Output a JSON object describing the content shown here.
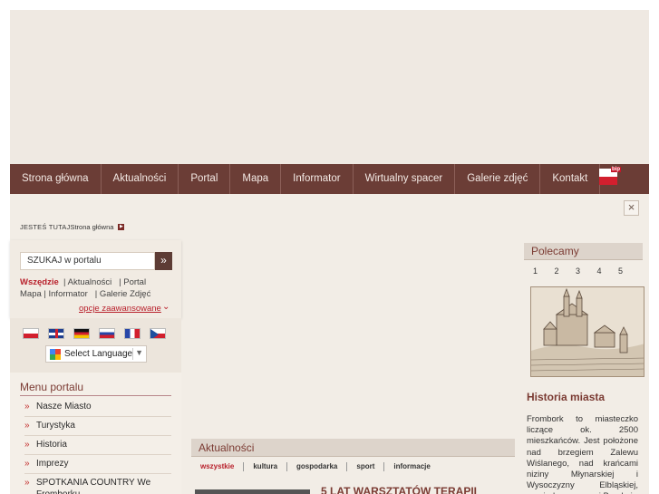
{
  "nav": {
    "items": [
      "Strona główna",
      "Aktualności",
      "Portal",
      "Mapa",
      "Informator",
      "Wirtualny spacer",
      "Galerie zdjęć",
      "Kontakt"
    ],
    "bip_label": "bip"
  },
  "breadcrumb": {
    "label": "JESTEŚ TUTAJ",
    "current": "Strona główna"
  },
  "search": {
    "placeholder": "SZUKAJ w portalu",
    "button_icon": "double-chevron-right-icon",
    "scope_all": "Wszędzie",
    "scope_news": "| Aktualności",
    "scope_portal": "| Portal",
    "scope_map": "Mapa",
    "scope_info": "| Informator",
    "scope_gallery": "| Galerie Zdjęć",
    "advanced": "opcje zaawansowane"
  },
  "languages": {
    "flags": [
      "pl",
      "en",
      "de",
      "ru",
      "fr",
      "cz"
    ],
    "translate_label": "Select Language"
  },
  "menu": {
    "title": "Menu portalu",
    "items": [
      "Nasze Miasto",
      "Turystyka",
      "Historia",
      "Imprezy",
      "SPOTKANIA COUNTRY We Fromborku"
    ]
  },
  "news": {
    "title": "Aktualności",
    "tabs": [
      "wszystkie",
      "kultura",
      "gospodarka",
      "sport",
      "informacje"
    ],
    "headline": "5 LAT WARSZTATÓW TERAPII"
  },
  "recommended": {
    "title": "Polecamy",
    "pages": [
      "1",
      "2",
      "3",
      "4",
      "5"
    ],
    "article_title": "Historia miasta",
    "article_text": "Frombork to miasteczko liczące ok. 2500 mieszkańców. Jest położone nad brzegiem Zalewu Wiślanego, nad krańcami niziny Młynarskiej i Wysoczyzny Elbląskiej, pomiędzy pasmami Braulo i"
  },
  "colors": {
    "nav_bg": "#6b3d36",
    "accent_red": "#b8202b",
    "heading": "#7b3b33",
    "panel_bg": "#f2ede6"
  }
}
